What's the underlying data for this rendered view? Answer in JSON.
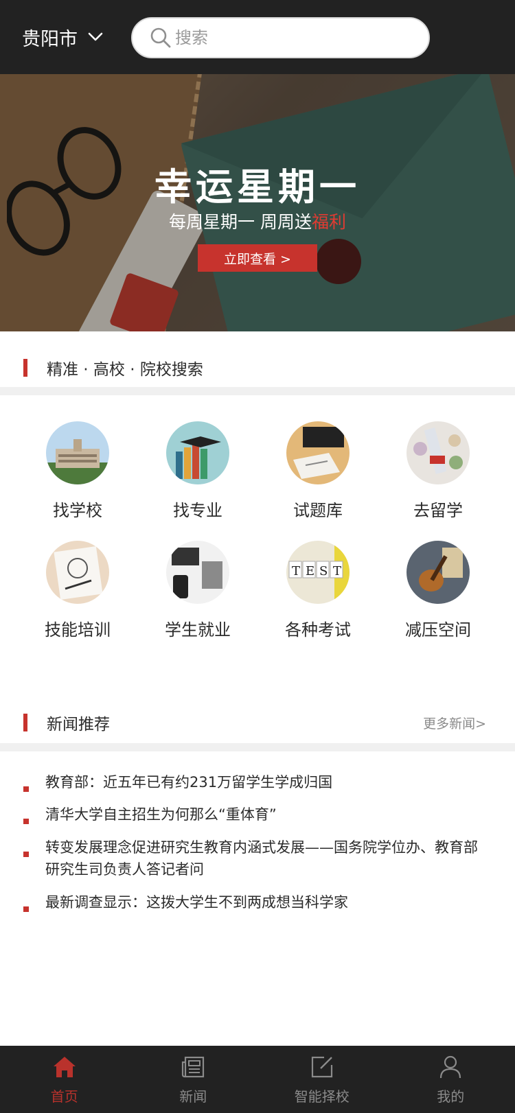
{
  "header": {
    "city": "贵阳市",
    "search_placeholder": "搜索"
  },
  "banner": {
    "title": "幸运星期一",
    "subtitle_prefix": "每周星期一  周周送",
    "subtitle_highlight": "福利",
    "button": "立即查看 >"
  },
  "schools": {
    "title": "精准 · 高校 · 院校搜索",
    "items": [
      {
        "label": "找学校",
        "icon": "campus-building-icon"
      },
      {
        "label": "找专业",
        "icon": "books-graduation-cap-icon"
      },
      {
        "label": "试题库",
        "icon": "desk-papers-icon"
      },
      {
        "label": "去留学",
        "icon": "diploma-flowers-icon"
      },
      {
        "label": "技能培训",
        "icon": "sketch-notebook-icon"
      },
      {
        "label": "学生就业",
        "icon": "laptop-workspace-icon"
      },
      {
        "label": "各种考试",
        "icon": "test-letters-icon"
      },
      {
        "label": "减压空间",
        "icon": "guitar-icon"
      }
    ]
  },
  "news": {
    "title": "新闻推荐",
    "more": "更多新闻>",
    "items": [
      "教育部：近五年已有约231万留学生学成归国",
      "清华大学自主招生为何那么“重体育”",
      "转变发展理念促进研究生教育内涵式发展——国务院学位办、教育部研究生司负责人答记者问",
      "最新调查显示：这拨大学生不到两成想当科学家"
    ]
  },
  "tabbar": {
    "items": [
      {
        "label": "首页",
        "icon": "home-icon"
      },
      {
        "label": "新闻",
        "icon": "newspaper-icon"
      },
      {
        "label": "智能择校",
        "icon": "edit-square-icon"
      },
      {
        "label": "我的",
        "icon": "user-icon"
      }
    ],
    "active_color": "#b9322c"
  },
  "colors": {
    "accent": "#c7332d",
    "header_bg": "#222222"
  }
}
